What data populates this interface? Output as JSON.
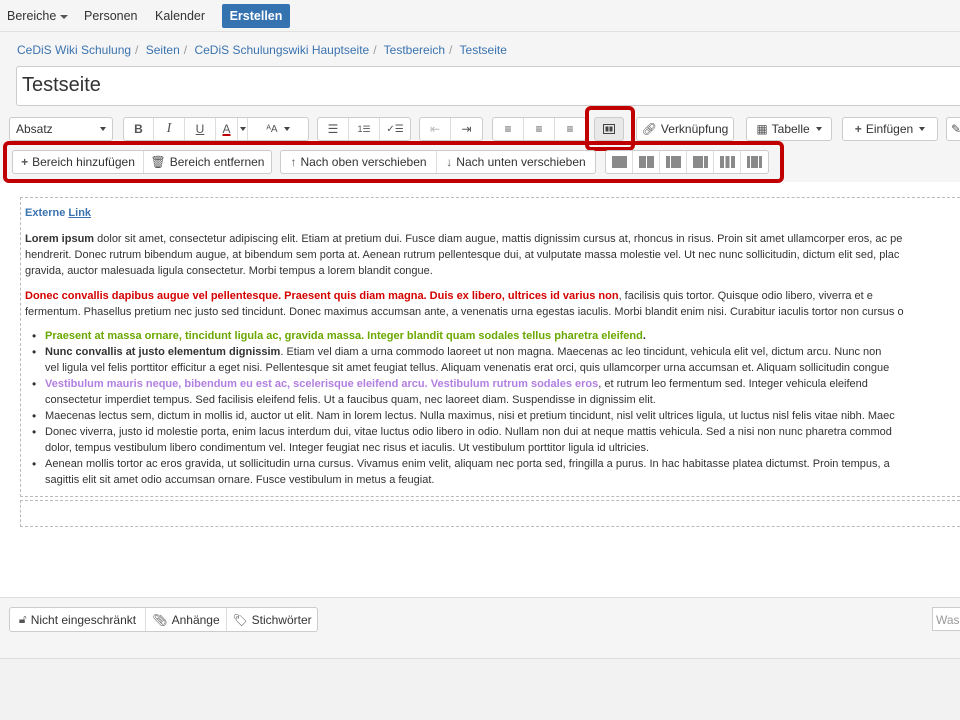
{
  "topnav": {
    "areas_label": "Bereiche",
    "people_label": "Personen",
    "calendar_label": "Kalender",
    "create_label": "Erstellen"
  },
  "breadcrumb": [
    "CeDiS Wiki Schulung",
    "Seiten",
    "CeDiS Schulungswiki Hauptseite",
    "Testbereich",
    "Testseite"
  ],
  "page_title": "Testseite",
  "toolbar": {
    "paragraph_style": "Absatz",
    "link_label": "Verknüpfung",
    "table_label": "Tabelle",
    "insert_label": "Einfügen"
  },
  "layout_toolbar": {
    "add_section": "Bereich hinzufügen",
    "remove_section": "Bereich entfernen",
    "move_up": "Nach oben verschieben",
    "move_down": "Nach unten verschieben"
  },
  "content": {
    "link_title_a": "Externe",
    "link_title_b": "Link",
    "p1_bold": "Lorem ipsum",
    "p1_l1": " dolor sit amet, consectetur adipiscing elit. Etiam at pretium dui. Fusce diam augue, mattis dignissim cursus at, rhoncus in risus. Proin sit amet ullamcorper eros, ac pe",
    "p1_l2": "hendrerit. Donec rutrum bibendum augue, at bibendum sem porta at. Aenean rutrum pellentesque dui, at vulputate massa molestie vel. Ut nec nunc sollicitudin, dictum elit sed, plac",
    "p1_l3": "gravida, auctor malesuada ligula consectetur. Morbi tempus a lorem blandit congue.",
    "p2_red": "Donec convallis dapibus augue vel pellentesque. Praesent quis diam magna. Duis ex libero, ultrices id varius non",
    "p2_l1": ", facilisis quis tortor. Quisque odio libero, viverra et e",
    "p2_l2": "fermentum. Phasellus pretium nec justo sed tincidunt. Donec maximus accumsan ante, a venenatis urna egestas iaculis. Morbi blandit enim nisi. Curabitur iaculis tortor non cursus o",
    "li1_green": "Praesent at massa ornare, tincidunt ligula ac, gravida massa. Integer blandit quam sodales tellus pharetra eleifend",
    "li1_end": ".",
    "li2_bold": " Nunc convallis at justo elementum dignissim",
    "li2_l1": ". Etiam vel diam a urna commodo laoreet ut non magna. Maecenas ac leo tincidunt, vehicula elit vel, dictum arcu. Nunc non",
    "li2_l2": "vel ligula vel felis porttitor efficitur a eget nisi. Pellentesque sit amet feugiat tellus. Aliquam venenatis erat orci, quis ullamcorper urna accumsan et. Aliquam sollicitudin congue",
    "li3_purple": "Vestibulum mauris neque, bibendum eu est ac, scelerisque eleifend arcu. Vestibulum rutrum sodales eros",
    "li3_l1": ", et rutrum leo fermentum sed. Integer vehicula eleifend",
    "li3_l2": "consectetur imperdiet tempus. Sed facilisis eleifend felis. Ut a faucibus quam, nec laoreet diam. Suspendisse in dignissim elit.",
    "li4": " Maecenas lectus sem, dictum in mollis id, auctor ut elit. Nam in lorem lectus. Nulla maximus, nisi et pretium tincidunt, nisl velit ultrices ligula, ut luctus nisl felis vitae nibh. Maec",
    "li5_l1": "Donec viverra, justo id molestie porta, enim lacus interdum dui, vitae luctus odio libero in odio. Nullam non dui at neque mattis vehicula. Sed a nisi non nunc pharetra commod",
    "li5_l2": "dolor, tempus vestibulum libero condimentum vel. Integer feugiat nec risus et iaculis. Ut vestibulum porttitor ligula id ultricies.",
    "li6_l1": "Aenean mollis tortor ac eros gravida, ut sollicitudin urna cursus. Vivamus enim velit, aliquam nec porta sed, fringilla a purus. In hac habitasse platea dictumst. Proin tempus, a",
    "li6_l2": "sagittis elit sit amet odio accumsan ornare. Fusce vestibulum in metus a feugiat."
  },
  "bottom": {
    "restrictions": "Nicht eingeschränkt",
    "attachments": "Anhänge",
    "labels": "Stichwörter",
    "search_placeholder": "Was"
  },
  "colors": {
    "accent": "#3572b0",
    "highlight": "#c00000",
    "link": "#3b73af",
    "red_text": "#d40000",
    "green_text": "#6aa800",
    "purple_text": "#b27fe0"
  },
  "icons": [
    "bold-icon",
    "italic-icon",
    "underline-icon",
    "text-color-icon",
    "font-size-icon",
    "bullet-list-icon",
    "numbered-list-icon",
    "task-list-icon",
    "outdent-icon",
    "indent-icon",
    "align-left-icon",
    "align-center-icon",
    "align-right-icon",
    "page-layout-icon",
    "link-icon",
    "table-icon",
    "plus-icon",
    "trash-icon",
    "arrow-up-icon",
    "arrow-down-icon",
    "lock-icon",
    "paperclip-icon",
    "tag-icon"
  ]
}
